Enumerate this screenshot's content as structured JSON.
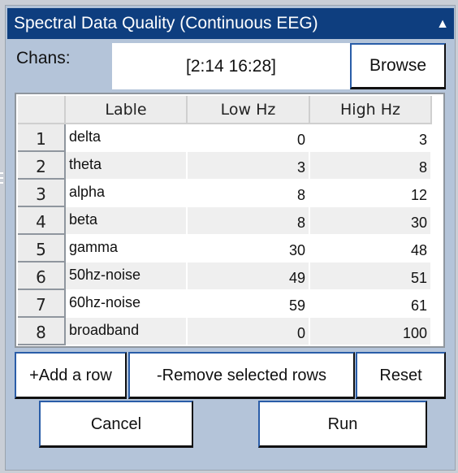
{
  "window": {
    "title": "Spectral Data Quality (Continuous EEG)",
    "collapse_icon": "▲"
  },
  "chans": {
    "label": "Chans:",
    "value": "[2:14 16:28]",
    "browse_label": "Browse"
  },
  "table": {
    "headers": [
      "",
      "Lable",
      "Low Hz",
      "High Hz"
    ],
    "rows": [
      {
        "num": "1",
        "label": "delta",
        "low": "0",
        "high": "3"
      },
      {
        "num": "2",
        "label": "theta",
        "low": "3",
        "high": "8"
      },
      {
        "num": "3",
        "label": "alpha",
        "low": "8",
        "high": "12"
      },
      {
        "num": "4",
        "label": "beta",
        "low": "8",
        "high": "30"
      },
      {
        "num": "5",
        "label": "gamma",
        "low": "30",
        "high": "48"
      },
      {
        "num": "6",
        "label": "50hz-noise",
        "low": "49",
        "high": "51"
      },
      {
        "num": "7",
        "label": "60hz-noise",
        "low": "59",
        "high": "61"
      },
      {
        "num": "8",
        "label": "broadband",
        "low": "0",
        "high": "100"
      }
    ]
  },
  "actions": {
    "add_row": "+Add a row",
    "remove_rows": "-Remove selected rows",
    "reset": "Reset",
    "cancel": "Cancel",
    "run": "Run"
  },
  "colors": {
    "titlebar": "#0e3e7f",
    "panel": "#b4c4d9",
    "button_highlight": "#2a5da8"
  }
}
